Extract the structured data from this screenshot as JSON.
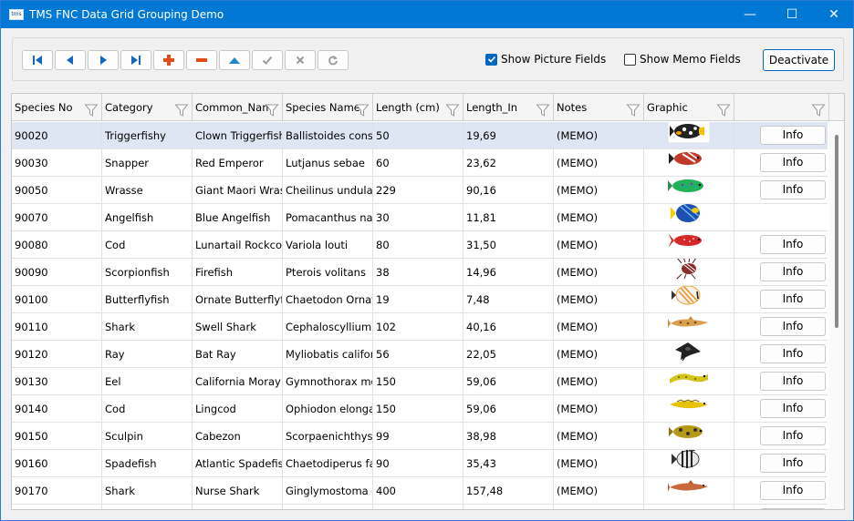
{
  "window": {
    "title": "TMS FNC Data Grid Grouping Demo",
    "app_icon_text": "tms",
    "minimize_glyph": "—",
    "maximize_glyph": "☐",
    "close_glyph": "✕"
  },
  "toolbar": {
    "nav_buttons": [
      {
        "name": "first-record-button",
        "icon": "first-icon",
        "enabled": true
      },
      {
        "name": "prior-record-button",
        "icon": "prior-icon",
        "enabled": true
      },
      {
        "name": "next-record-button",
        "icon": "next-icon",
        "enabled": true
      },
      {
        "name": "last-record-button",
        "icon": "last-icon",
        "enabled": true
      },
      {
        "name": "insert-record-button",
        "icon": "plus-icon",
        "enabled": true
      },
      {
        "name": "delete-record-button",
        "icon": "minus-icon",
        "enabled": true
      },
      {
        "name": "edit-record-button",
        "icon": "up-triangle-icon",
        "enabled": true
      },
      {
        "name": "post-record-button",
        "icon": "checkmark-icon",
        "enabled": false
      },
      {
        "name": "cancel-record-button",
        "icon": "cross-icon",
        "enabled": false
      },
      {
        "name": "refresh-record-button",
        "icon": "refresh-icon",
        "enabled": false
      }
    ],
    "show_picture_fields": {
      "label": "Show Picture Fields",
      "checked": true
    },
    "show_memo_fields": {
      "label": "Show Memo Fields",
      "checked": false
    },
    "deactivate_label": "Deactivate"
  },
  "grid": {
    "columns": [
      "Species No",
      "Category",
      "Common_Nam",
      "Species Name",
      "Length (cm)",
      "Length_In",
      "Notes",
      "Graphic",
      ""
    ],
    "info_label": "Info",
    "rows": [
      {
        "species_no": "90020",
        "category": "Triggerfishy",
        "common_name": "Clown Triggerfish",
        "species_name": "Ballistoides conspicillum",
        "length_cm": "50",
        "length_in": "19,69",
        "notes": "(MEMO)",
        "fish": "triggerfish",
        "selected": true,
        "info": true
      },
      {
        "species_no": "90030",
        "category": "Snapper",
        "common_name": "Red Emperor",
        "species_name": "Lutjanus sebae",
        "length_cm": "60",
        "length_in": "23,62",
        "notes": "(MEMO)",
        "fish": "snapper",
        "selected": false,
        "info": true
      },
      {
        "species_no": "90050",
        "category": "Wrasse",
        "common_name": "Giant Maori Wrasse",
        "species_name": "Cheilinus undulatus",
        "length_cm": "229",
        "length_in": "90,16",
        "notes": "(MEMO)",
        "fish": "wrasse",
        "selected": false,
        "info": true
      },
      {
        "species_no": "90070",
        "category": "Angelfish",
        "common_name": "Blue Angelfish",
        "species_name": "Pomacanthus nauarchus",
        "length_cm": "30",
        "length_in": "11,81",
        "notes": "(MEMO)",
        "fish": "angelfish",
        "selected": false,
        "info": false
      },
      {
        "species_no": "90080",
        "category": "Cod",
        "common_name": "Lunartail Rockcod",
        "species_name": "Variola louti",
        "length_cm": "80",
        "length_in": "31,50",
        "notes": "(MEMO)",
        "fish": "rockcod",
        "selected": false,
        "info": true
      },
      {
        "species_no": "90090",
        "category": "Scorpionfish",
        "common_name": "Firefish",
        "species_name": "Pterois volitans",
        "length_cm": "38",
        "length_in": "14,96",
        "notes": "(MEMO)",
        "fish": "firefish",
        "selected": false,
        "info": true
      },
      {
        "species_no": "90100",
        "category": "Butterflyfish",
        "common_name": "Ornate Butterflyfish",
        "species_name": "Chaetodon Ornatissimus",
        "length_cm": "19",
        "length_in": "7,48",
        "notes": "(MEMO)",
        "fish": "butterflyfish",
        "selected": false,
        "info": true
      },
      {
        "species_no": "90110",
        "category": "Shark",
        "common_name": "Swell Shark",
        "species_name": "Cephaloscyllium ventriosum",
        "length_cm": "102",
        "length_in": "40,16",
        "notes": "(MEMO)",
        "fish": "swellshark",
        "selected": false,
        "info": true
      },
      {
        "species_no": "90120",
        "category": "Ray",
        "common_name": "Bat Ray",
        "species_name": "Myliobatis californica",
        "length_cm": "56",
        "length_in": "22,05",
        "notes": "(MEMO)",
        "fish": "ray",
        "selected": false,
        "info": true
      },
      {
        "species_no": "90130",
        "category": "Eel",
        "common_name": "California Moray",
        "species_name": "Gymnothorax mordax",
        "length_cm": "150",
        "length_in": "59,06",
        "notes": "(MEMO)",
        "fish": "moray",
        "selected": false,
        "info": true
      },
      {
        "species_no": "90140",
        "category": "Cod",
        "common_name": "Lingcod",
        "species_name": "Ophiodon elongatus",
        "length_cm": "150",
        "length_in": "59,06",
        "notes": "(MEMO)",
        "fish": "lingcod",
        "selected": false,
        "info": true
      },
      {
        "species_no": "90150",
        "category": "Sculpin",
        "common_name": "Cabezon",
        "species_name": "Scorpaenichthys marmoratus",
        "length_cm": "99",
        "length_in": "38,98",
        "notes": "(MEMO)",
        "fish": "cabezon",
        "selected": false,
        "info": true
      },
      {
        "species_no": "90160",
        "category": "Spadefish",
        "common_name": "Atlantic Spadefish",
        "species_name": "Chaetodiperus faber",
        "length_cm": "90",
        "length_in": "35,43",
        "notes": "(MEMO)",
        "fish": "spadefish",
        "selected": false,
        "info": true
      },
      {
        "species_no": "90170",
        "category": "Shark",
        "common_name": "Nurse Shark",
        "species_name": "Ginglymostoma cirratum",
        "length_cm": "400",
        "length_in": "157,48",
        "notes": "(MEMO)",
        "fish": "nurseshark",
        "selected": false,
        "info": true
      },
      {
        "species_no": "",
        "category": "",
        "common_name": "",
        "species_name": "",
        "length_cm": "",
        "length_in": "",
        "notes": "",
        "fish": "partial",
        "selected": false,
        "info": true
      }
    ]
  },
  "colors": {
    "titlebar": "#0078d4",
    "selected_row": "#dde6f2",
    "accent": "#0067c0",
    "nav_blue": "#1565c0",
    "nav_red": "#e64a19",
    "nav_teal": "#1e88c8",
    "disabled": "#9a9a9a"
  }
}
